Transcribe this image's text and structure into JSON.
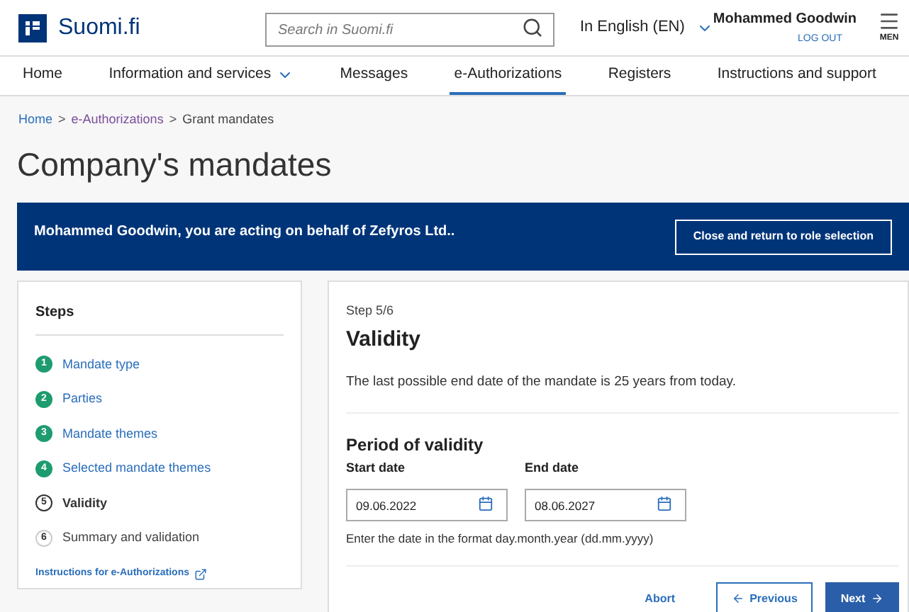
{
  "header": {
    "logo_text": "Suomi.fi",
    "search": {
      "placeholder": "Search in Suomi.fi"
    },
    "language": "In English (EN)",
    "user": {
      "name": "Mohammed Goodwin",
      "logout": "LOG OUT"
    },
    "menu_label": "MEN"
  },
  "nav": {
    "items": [
      {
        "label": "Home",
        "selected": false,
        "dropdown": false
      },
      {
        "label": "Information and services",
        "selected": false,
        "dropdown": true
      },
      {
        "label": "Messages",
        "selected": false,
        "dropdown": false
      },
      {
        "label": "e-Authorizations",
        "selected": true,
        "dropdown": false
      },
      {
        "label": "Registers",
        "selected": false,
        "dropdown": false
      },
      {
        "label": "Instructions and support",
        "selected": false,
        "dropdown": false
      }
    ]
  },
  "breadcrumb": [
    {
      "label": "Home",
      "link": true
    },
    {
      "label": "e-Authorizations",
      "link": true
    },
    {
      "label": "Grant mandates",
      "link": false
    }
  ],
  "breadcrumb_separator": ">",
  "page_title": "Company's mandates",
  "banner": {
    "text": "Mohammed Goodwin, you are acting on behalf of Zefyros Ltd..",
    "button": "Close and return to role selection"
  },
  "steps": {
    "title": "Steps",
    "items": [
      {
        "number": "1",
        "label": "Mandate type",
        "completed": true,
        "selected": false
      },
      {
        "number": "2",
        "label": "Parties",
        "completed": true,
        "selected": false
      },
      {
        "number": "3",
        "label": "Mandate themes",
        "completed": true,
        "selected": false
      },
      {
        "number": "4",
        "label": "Selected mandate themes",
        "completed": true,
        "selected": false
      },
      {
        "number": "5",
        "label": "Validity",
        "completed": false,
        "selected": true
      },
      {
        "number": "6",
        "label": "Summary and validation",
        "completed": false,
        "selected": false
      }
    ],
    "instructions_link": "Instructions for e-Authorizations"
  },
  "form": {
    "step": "Step 5/6",
    "title": "Validity",
    "description": "The last possible end date of the mandate is 25 years from today.",
    "section_title": "Period of validity",
    "fields": [
      {
        "label": "Start date",
        "value": "09.06.2022"
      },
      {
        "label": "End date",
        "value": "08.06.2027"
      }
    ],
    "hint": "Enter the date in the format day.month.year (dd.mm.yyyy)",
    "buttons": {
      "abort": "Abort",
      "previous": "Previous",
      "next": "Next"
    }
  }
}
